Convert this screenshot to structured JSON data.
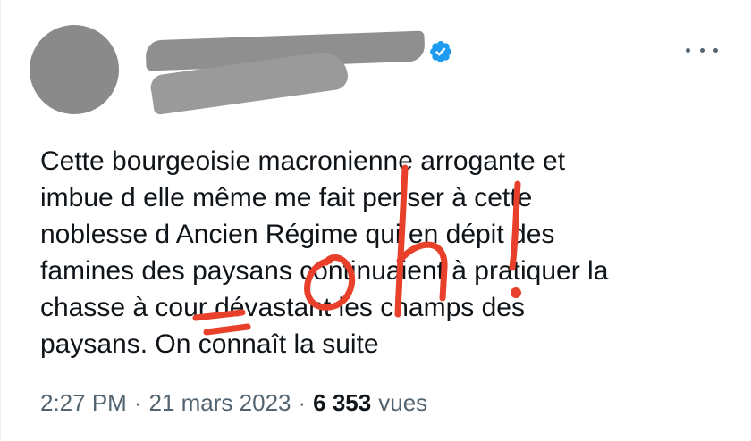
{
  "tweet": {
    "handle_prefix": "@",
    "text": "Cette bourgeoisie macronienne  arrogante et\nimbue d elle même me fait penser à cette\nnoblesse d Ancien Régime qui en dépit des\nfamines des paysans continuaient à pratiquer la\nchasse à cour dévastant les champs des\npaysans. On connaît la suite",
    "time": "2:27 PM",
    "date": "21 mars 2023",
    "separator": "·",
    "views_count": "6 353",
    "views_label": "vues"
  },
  "colors": {
    "verified": "#1d9bf0",
    "annotation": "#e8402a",
    "redaction": "#8f8f8f"
  },
  "icons": {
    "verified": "verified-badge-icon",
    "more": "more-options-icon"
  }
}
